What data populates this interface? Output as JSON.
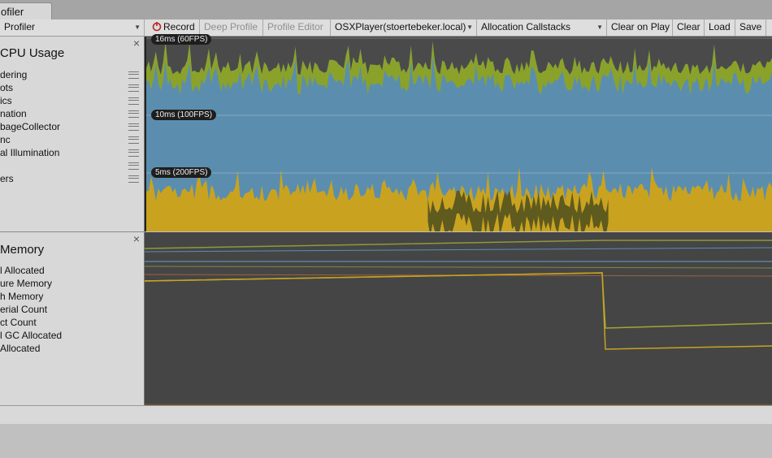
{
  "window": {
    "tab_label": "ofiler"
  },
  "toolbar": {
    "profiler_dropdown": "Profiler",
    "record": "Record",
    "deep_profile": "Deep Profile",
    "profile_editor": "Profile Editor",
    "player_dropdown": "OSXPlayer(stoertebeker.local)",
    "callstacks_dropdown": "Allocation Callstacks",
    "clear_on_play": "Clear on Play",
    "clear": "Clear",
    "load": "Load",
    "save": "Save"
  },
  "cpu": {
    "title": "CPU Usage",
    "close_glyph": "×",
    "legend": [
      "dering",
      "ots",
      "ics",
      "nation",
      "bageCollector",
      "nc",
      "al Illumination",
      "",
      "ers"
    ],
    "fps_markers": [
      "16ms (60FPS)",
      "10ms (100FPS)",
      "5ms (200FPS)"
    ],
    "colors": {
      "background": "#5b8eae",
      "rendering": "#8aa22a",
      "scripts": "#c9a31f",
      "gc": "#5f5a1e"
    }
  },
  "memory": {
    "title": "Memory",
    "close_glyph": "×",
    "legend": [
      "l Allocated",
      "ure Memory",
      "h Memory",
      "erial Count",
      "ct Count",
      "l GC Allocated",
      "Allocated"
    ],
    "colors": {
      "background": "#454545"
    }
  },
  "icons": {
    "record": "record-icon",
    "dropdown": "dropdown-arrow-icon",
    "close": "close-icon",
    "drag": "drag-handle-icon"
  }
}
